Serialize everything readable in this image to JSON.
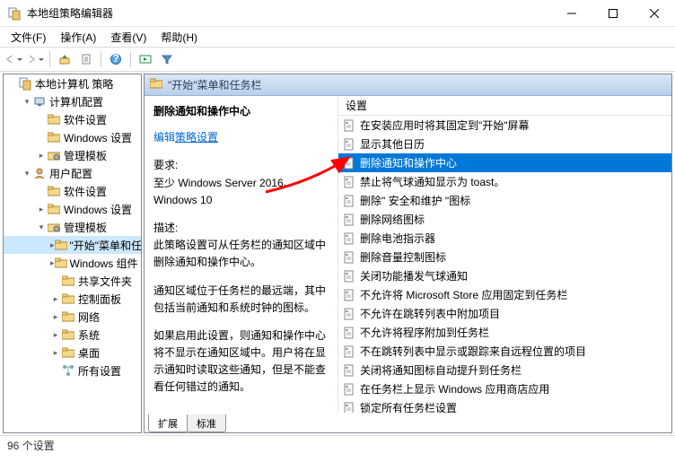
{
  "window": {
    "title": "本地组策略编辑器"
  },
  "menu": {
    "file": "文件(F)",
    "action": "操作(A)",
    "view": "查看(V)",
    "help": "帮助(H)"
  },
  "tree": {
    "root": {
      "label": "本地计算机 策略"
    },
    "cc": {
      "label": "计算机配置"
    },
    "cc_sw": {
      "label": "软件设置"
    },
    "cc_win": {
      "label": "Windows 设置"
    },
    "cc_adm": {
      "label": "管理模板"
    },
    "uc": {
      "label": "用户配置"
    },
    "uc_sw": {
      "label": "软件设置"
    },
    "uc_win": {
      "label": "Windows 设置"
    },
    "uc_adm": {
      "label": "管理模板"
    },
    "start": {
      "label": "\"开始\"菜单和任务栏"
    },
    "wincomp": {
      "label": "Windows 组件"
    },
    "share": {
      "label": "共享文件夹"
    },
    "ctrl": {
      "label": "控制面板"
    },
    "net": {
      "label": "网络"
    },
    "sys": {
      "label": "系统"
    },
    "desk": {
      "label": "桌面"
    },
    "all": {
      "label": "所有设置"
    }
  },
  "header": {
    "title": "\"开始\"菜单和任务栏"
  },
  "desc": {
    "title": "删除通知和操作中心",
    "edit_prefix": "编辑",
    "edit_link": "策略设置",
    "req_label": "要求:",
    "req_text": "至少 Windows Server 2016、Windows 10",
    "desc_label": "描述:",
    "p1": "此策略设置可从任务栏的通知区域中删除通知和操作中心。",
    "p2": "通知区域位于任务栏的最远端，其中包括当前通知和系统时钟的图标。",
    "p3": "如果启用此设置，则通知和操作中心将不显示在通知区域中。用户将在显示通知时读取这些通知，但是不能查看任何错过的通知。"
  },
  "list": {
    "col_setting": "设置",
    "items": [
      "在安装应用时将其固定到\"开始\"屏幕",
      "显示其他日历",
      "删除通知和操作中心",
      "禁止将气球通知显示为 toast。",
      "删除\" 安全和维护 \"图标",
      "删除网络图标",
      "删除电池指示器",
      "删除音量控制图标",
      "关闭功能播发气球通知",
      "不允许将 Microsoft Store 应用固定到任务栏",
      "不允许在跳转列表中附加项目",
      "不允许将程序附加到任务栏",
      "不在跳转列表中显示或跟踪来自远程位置的项目",
      "关闭将通知图标自动提升到任务栏",
      "在任务栏上显示 Windows 应用商店应用",
      "锁定所有任务栏设置"
    ],
    "selected_index": 2
  },
  "tabs": {
    "ext": "扩展",
    "std": "标准"
  },
  "status": {
    "text": "96 个设置"
  }
}
